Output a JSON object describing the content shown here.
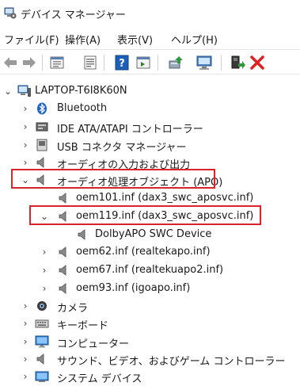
{
  "window": {
    "title": "デバイス マネージャー",
    "title_icon": "device-manager-icon"
  },
  "menu": [
    {
      "label": "ファイル(F)"
    },
    {
      "label": "操作(A)"
    },
    {
      "label": "表示(V)"
    },
    {
      "label": "ヘルプ(H)"
    }
  ],
  "toolbar": [
    {
      "icon": "back-arrow-icon"
    },
    {
      "icon": "forward-arrow-icon"
    },
    {
      "icon": "properties-sheet-icon"
    },
    {
      "icon": "show-hidden-icon"
    },
    {
      "icon": "help-icon"
    },
    {
      "icon": "action-pane-icon"
    },
    {
      "icon": "update-driver-icon"
    },
    {
      "icon": "scan-hardware-icon"
    },
    {
      "icon": "enable-device-icon"
    },
    {
      "icon": "uninstall-device-icon"
    }
  ],
  "accent": {
    "highlight_color": "#d9252a",
    "uninstall_color": "#e02020",
    "help_color": "#1c5fb8"
  },
  "tree": {
    "root": {
      "label": "LAPTOP-T6I8K60N",
      "expanded": true,
      "icon": "computer-icon"
    },
    "items": [
      {
        "label": "Bluetooth",
        "icon": "bluetooth-icon",
        "expanded": false
      },
      {
        "label": "IDE ATA/ATAPI コントローラー",
        "icon": "ide-controller-icon",
        "expanded": false
      },
      {
        "label": "USB コネクタ マネージャー",
        "icon": "usb-connector-icon",
        "expanded": false
      },
      {
        "label": "オーディオの入力および出力",
        "icon": "speaker-icon",
        "expanded": false
      },
      {
        "label": "オーディオ処理オブジェクト (APO)",
        "icon": "speaker-icon",
        "expanded": true,
        "highlighted": true
      },
      {
        "label": "oem101.inf (dax3_swc_aposvc.inf)",
        "icon": "speaker-icon",
        "expanded": null
      },
      {
        "label": "oem119.inf (dax3_swc_aposvc.inf)",
        "icon": "speaker-icon",
        "expanded": true,
        "highlighted": true
      },
      {
        "label": "DolbyAPO SWC Device",
        "icon": "speaker-icon",
        "expanded": null
      },
      {
        "label": "oem62.inf (realtekapo.inf)",
        "icon": "speaker-icon",
        "expanded": false
      },
      {
        "label": "oem67.inf (realtekuapo2.inf)",
        "icon": "speaker-icon",
        "expanded": false
      },
      {
        "label": "oem93.inf (igoapo.inf)",
        "icon": "speaker-icon",
        "expanded": false
      },
      {
        "label": "カメラ",
        "icon": "camera-icon",
        "expanded": false
      },
      {
        "label": "キーボード",
        "icon": "keyboard-icon",
        "expanded": false
      },
      {
        "label": "コンピューター",
        "icon": "monitor-icon",
        "expanded": false
      },
      {
        "label": "サウンド、ビデオ、およびゲーム コントローラー",
        "icon": "speaker-icon",
        "expanded": false
      },
      {
        "label": "システム デバイス",
        "icon": "system-devices-icon",
        "expanded": false
      }
    ]
  }
}
